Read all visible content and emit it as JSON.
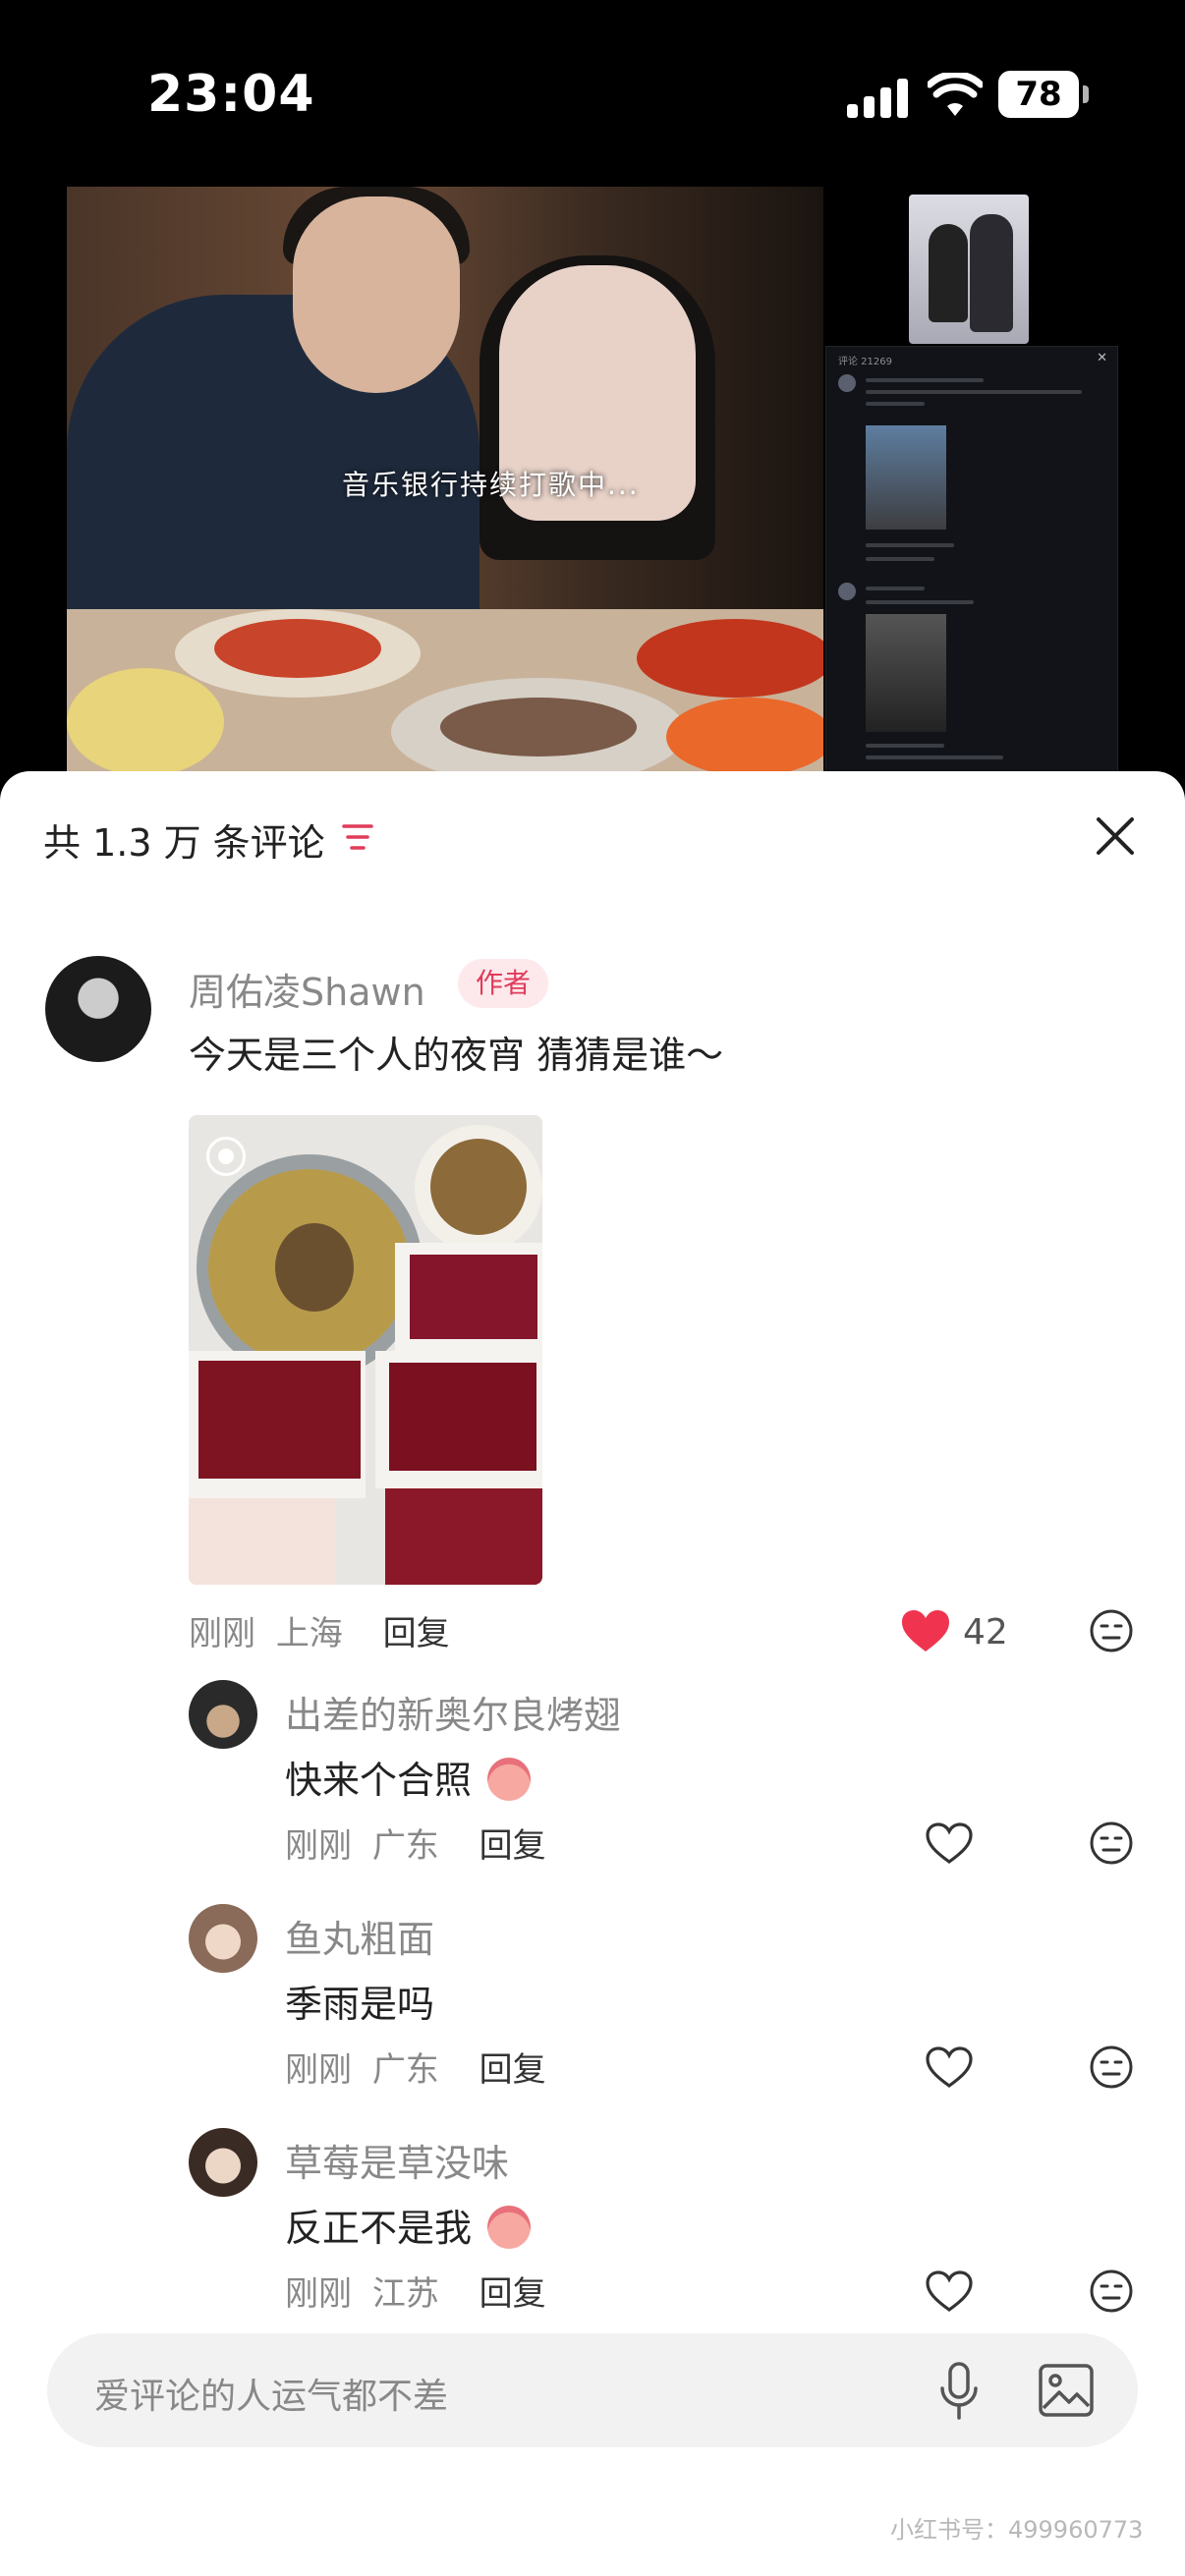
{
  "status_bar": {
    "time": "23:04",
    "battery": "78"
  },
  "video": {
    "caption": "音乐银行持续打歌中..."
  },
  "inset": {
    "header": "评论 21269"
  },
  "comments_sheet": {
    "title": "共 1.3 万 条评论",
    "main_comment": {
      "author": "周佑凌Shawn",
      "badge": "作者",
      "text": "今天是三个人的夜宵 猜猜是谁～",
      "time": "刚刚",
      "location": "上海",
      "reply_label": "回复",
      "likes": "42",
      "liked": true
    },
    "replies": [
      {
        "author": "出差的新奥尔良烤翅",
        "text": "快来个合照",
        "emoji": "peach-face",
        "time": "刚刚",
        "location": "广东",
        "reply_label": "回复"
      },
      {
        "author": "鱼丸粗面",
        "text": "季雨是吗",
        "time": "刚刚",
        "location": "广东",
        "reply_label": "回复"
      },
      {
        "author": "草莓是草没味",
        "text": "反正不是我",
        "emoji": "peach-face",
        "time": "刚刚",
        "location": "江苏",
        "reply_label": "回复"
      }
    ]
  },
  "input": {
    "placeholder": "爱评论的人运气都不差"
  },
  "watermark": "小红书号：499960773",
  "colors": {
    "accent": "#e03c5a",
    "heart": "#f0344f"
  }
}
